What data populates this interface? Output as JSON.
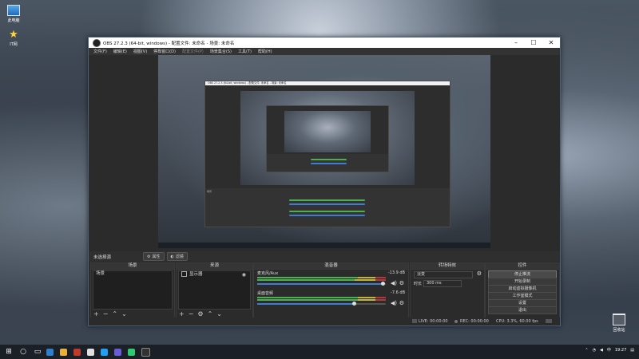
{
  "desktop": {
    "icons": [
      {
        "label": "此电脑",
        "icon": "computer-icon"
      },
      {
        "label": "IT网",
        "icon": "star-icon"
      },
      {
        "label": "回收站",
        "icon": "recycle-bin-icon"
      }
    ]
  },
  "obs": {
    "title": "OBS 27.2.3 (64-bit, windows) - 配置文件: 未命名 - 场景: 未命名",
    "menu": [
      "文件(F)",
      "编辑(E)",
      "视图(V)",
      "停靠窗口(D)",
      "配置文件(P)",
      "场景集合(S)",
      "工具(T)",
      "帮助(H)"
    ],
    "nested_title": "OBS 27.2.3 (64-bit, windows) - 配置文件: 未命名 - 场景: 未命名",
    "scenebar": {
      "label": "未选择源",
      "props_label": "属性",
      "filters_label": "滤镜"
    },
    "docks": {
      "scenes": {
        "title": "场景",
        "items": [
          "场景"
        ]
      },
      "sources": {
        "title": "来源",
        "items": [
          "显示器"
        ]
      },
      "mixer": {
        "title": "混音器",
        "channels": [
          {
            "name": "麦克风/Aux",
            "db": "-13.9 dB"
          },
          {
            "name": "桌面音频",
            "db": "-7.6 dB"
          }
        ]
      },
      "transitions": {
        "title": "转场特效",
        "type": "淡变",
        "duration_label": "时长",
        "duration_value": "300 ms"
      },
      "controls": {
        "title": "控件",
        "buttons": [
          "停止推流",
          "开始录制",
          "启动虚拟摄像机",
          "工作室模式",
          "设置",
          "退出"
        ]
      }
    },
    "status": {
      "live": "LIVE: 00:00:00",
      "rec": "REC: 00:00:00",
      "cpu": "CPU: 3.3%, 60.00 fps"
    }
  },
  "taskbar": {
    "time": "19:27",
    "tray_icons": [
      "chevron-up-icon",
      "wifi-icon",
      "speaker-icon",
      "ime-icon"
    ],
    "ime": "中"
  },
  "colors": {
    "meter_green": "#4caf50",
    "meter_yellow": "#c2b33a",
    "meter_red": "#b03a3a",
    "slider_blue": "#3d7cd0"
  }
}
